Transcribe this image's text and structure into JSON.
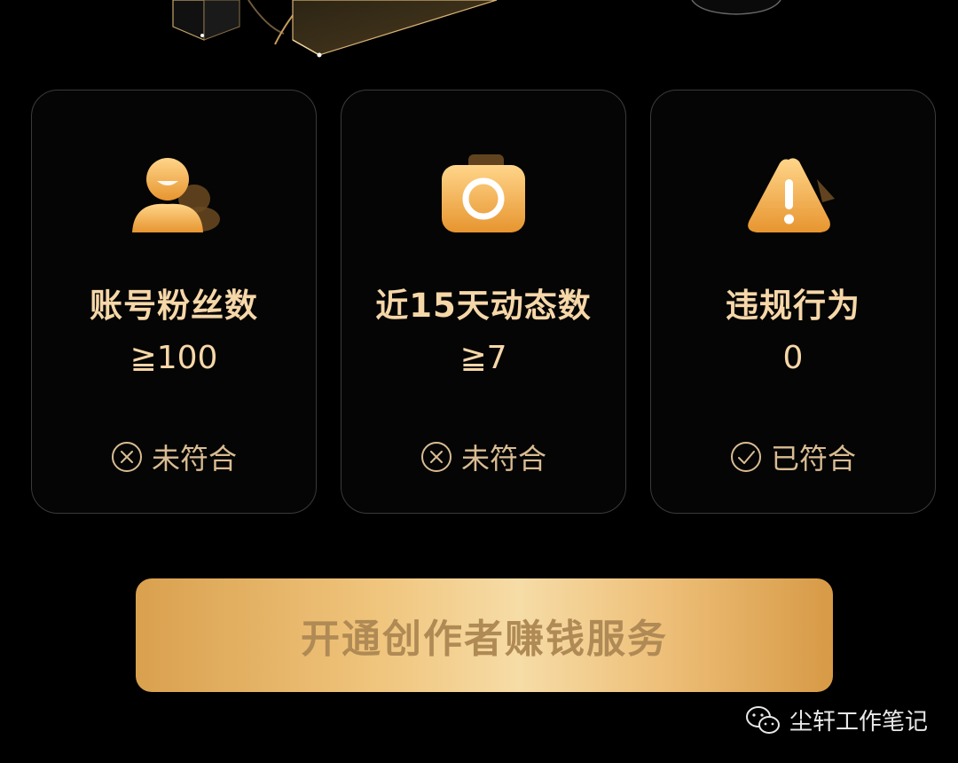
{
  "cards": [
    {
      "title": "账号粉丝数",
      "value": "≧100",
      "status": "未符合",
      "icon": "fans-user-icon",
      "status_icon": "x-circle-icon"
    },
    {
      "title": "近15天动态数",
      "value": "≧7",
      "status": "未符合",
      "icon": "camera-icon",
      "status_icon": "x-circle-icon"
    },
    {
      "title": "违规行为",
      "value": "0",
      "status": "已符合",
      "icon": "warning-icon",
      "status_icon": "check-circle-icon"
    }
  ],
  "cta": {
    "label": "开通创作者赚钱服务"
  },
  "watermark": {
    "text": "尘轩工作笔记",
    "icon": "wechat-icon"
  },
  "colors": {
    "background": "#000000",
    "gold_text": "#f6d7a8",
    "card_border": "#3a3a3a",
    "cta_gradient_mid": "#f6dca6",
    "cta_text": "#b08a55"
  }
}
